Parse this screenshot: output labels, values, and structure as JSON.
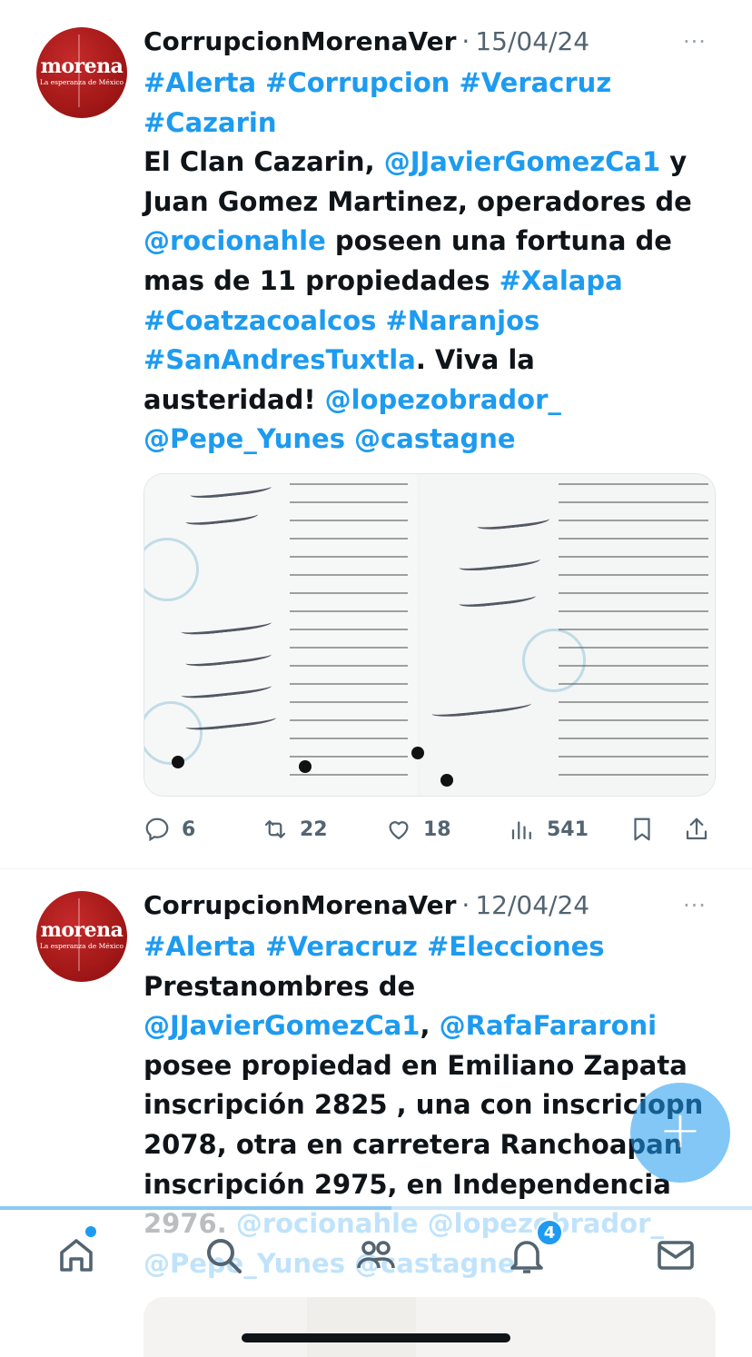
{
  "tweets": [
    {
      "avatar": {
        "brand": "morena",
        "slogan": "La esperanza de México"
      },
      "name": "CorrupcionMorenaVer",
      "separator": "·",
      "date": "15/04/24",
      "more": "···",
      "lines": [
        [
          {
            "t": "#Alerta #Corrupcion #Veracruz",
            "tag": true
          }
        ],
        [
          {
            "t": "#Cazarin",
            "tag": true
          }
        ],
        [
          {
            "t": "El Clan Cazarin, ",
            "tag": false
          },
          {
            "t": "@JJavierGomezCa1",
            "tag": true
          },
          {
            "t": " y",
            "tag": false
          }
        ],
        [
          {
            "t": "Juan Gomez Martinez, operadores de",
            "tag": false
          }
        ],
        [
          {
            "t": "@rocionahle",
            "tag": true
          },
          {
            "t": " poseen una fortuna de",
            "tag": false
          }
        ],
        [
          {
            "t": "mas de 11 propiedades ",
            "tag": false
          },
          {
            "t": "#Xalapa",
            "tag": true
          }
        ],
        [
          {
            "t": "#Coatzacoalcos #Naranjos",
            "tag": true
          }
        ],
        [
          {
            "t": "#SanAndresTuxtla",
            "tag": true
          },
          {
            "t": ". Viva la",
            "tag": false
          }
        ],
        [
          {
            "t": "austeridad!  ",
            "tag": false
          },
          {
            "t": "@lopezobrador_",
            "tag": true
          }
        ],
        [
          {
            "t": "@Pepe_Yunes @castagne",
            "tag": true
          }
        ]
      ],
      "actions": {
        "replies": "6",
        "retweets": "22",
        "likes": "18",
        "views": "541"
      }
    },
    {
      "avatar": {
        "brand": "morena",
        "slogan": "La esperanza de México"
      },
      "name": "CorrupcionMorenaVer",
      "separator": "·",
      "date": "12/04/24",
      "more": "···",
      "lines": [
        [
          {
            "t": "#Alerta #Veracruz #Elecciones",
            "tag": true
          }
        ],
        [
          {
            "t": "Prestanombres de",
            "tag": false
          }
        ],
        [
          {
            "t": "@JJavierGomezCa1",
            "tag": true
          },
          {
            "t": ", ",
            "tag": false
          },
          {
            "t": "@RafaFararoni",
            "tag": true
          }
        ],
        [
          {
            "t": "posee propiedad en Emiliano Zapata",
            "tag": false
          }
        ],
        [
          {
            "t": "inscripción 2825 , una con inscriciopn",
            "tag": false
          }
        ],
        [
          {
            "t": "2078, otra en carretera Ranchoapan",
            "tag": false
          }
        ],
        [
          {
            "t": "inscripción 2975, en Independencia",
            "tag": false
          }
        ],
        [
          {
            "t": "2976. ",
            "tag": false
          },
          {
            "t": "@rocionahle @lopezobrador_",
            "tag": true
          }
        ],
        [
          {
            "t": "@Pepe_Yunes @castagne",
            "tag": true
          }
        ]
      ]
    }
  ],
  "fab": {
    "label": "+"
  },
  "scroll_progress": 0.52,
  "tabbar": {
    "tabs": [
      {
        "name": "home-tab",
        "icon": "home-icon"
      },
      {
        "name": "search-tab",
        "icon": "search-icon"
      },
      {
        "name": "communities-tab",
        "icon": "people-icon"
      },
      {
        "name": "notifications-tab",
        "icon": "bell-icon"
      },
      {
        "name": "messages-tab",
        "icon": "mail-icon"
      }
    ],
    "notifications_badge": "4"
  },
  "colors": {
    "accent": "#1d9bf0",
    "text": "#0f1419",
    "muted": "#536471"
  }
}
